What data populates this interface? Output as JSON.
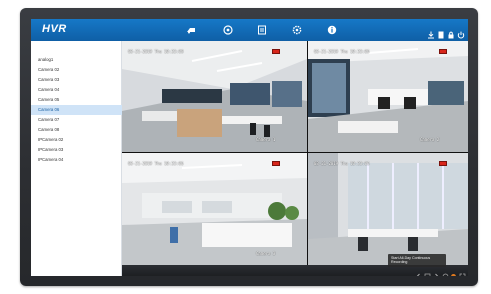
{
  "app": {
    "brand": "HVR"
  },
  "colors": {
    "topbar": "#1270bd",
    "selected_row": "#cfe3f7",
    "rec_badge": "#d8261b"
  },
  "top_nav": [
    {
      "name": "live-view-icon"
    },
    {
      "name": "playback-icon"
    },
    {
      "name": "backup-icon"
    },
    {
      "name": "settings-icon"
    },
    {
      "name": "info-icon"
    }
  ],
  "top_right": [
    {
      "name": "download-icon"
    },
    {
      "name": "document-icon"
    },
    {
      "name": "lock-icon"
    },
    {
      "name": "power-icon"
    }
  ],
  "sidebar": {
    "items": [
      {
        "label": "analog1"
      },
      {
        "label": "Camera 02"
      },
      {
        "label": "Camera 03"
      },
      {
        "label": "Camera 04"
      },
      {
        "label": "Camera 05"
      },
      {
        "label": "Camera 06",
        "selected": true
      },
      {
        "label": "Camera 07"
      },
      {
        "label": "Camera 08"
      },
      {
        "label": "IPCamera 02"
      },
      {
        "label": "IPCamera 03"
      },
      {
        "label": "IPCamera 04"
      }
    ]
  },
  "tiles": [
    {
      "date": "03-21-2019 Thu 10:33:08",
      "name": "Camera 1"
    },
    {
      "date": "03-21-2019 Thu 10:33:06",
      "name": "Camera 2"
    },
    {
      "date": "03-21-2019 Thu 10:33:06",
      "name": "Camera 3"
    },
    {
      "date": "03-21-2019 Thu 10:33:06",
      "name": ""
    }
  ],
  "tooltip": {
    "line1": "Start All-Day Continuous",
    "line2": "Recording"
  }
}
